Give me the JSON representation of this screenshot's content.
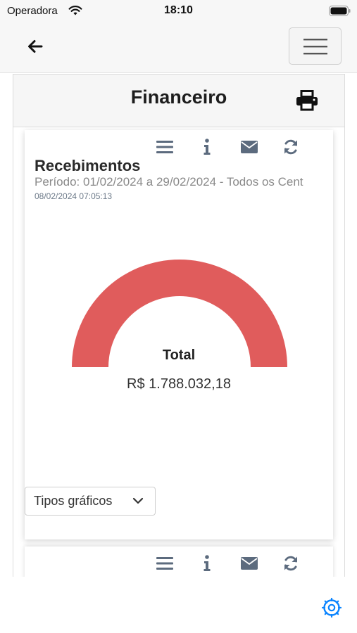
{
  "status_bar": {
    "carrier": "Operadora",
    "time": "18:10"
  },
  "nav": {
    "back_icon": "arrow-left-icon",
    "menu_icon": "hamburger-menu-icon"
  },
  "page": {
    "title": "Financeiro",
    "print_icon": "printer-icon"
  },
  "card": {
    "title": "Recebimentos",
    "period": "Período: 01/02/2024 a 29/02/2024 - Todos os Cent",
    "timestamp": "08/02/2024 07:05:13",
    "toolbar": [
      "list-icon",
      "info-icon",
      "envelope-icon",
      "refresh-icon"
    ],
    "chart_type_select": {
      "selected": "Tipos gráficos"
    }
  },
  "chart_data": {
    "type": "pie",
    "subtype": "half-donut",
    "categories": [
      "Total"
    ],
    "values": [
      1788032.18
    ],
    "center_label": "Total",
    "center_value": "R$ 1.788.032,18",
    "color": "#e05c5c"
  },
  "card2": {
    "toolbar": [
      "list-icon",
      "info-icon",
      "envelope-icon",
      "refresh-icon"
    ]
  },
  "colors": {
    "accent": "#0a84ff",
    "icon": "#5c6b7e",
    "gauge": "#e05c5c"
  }
}
